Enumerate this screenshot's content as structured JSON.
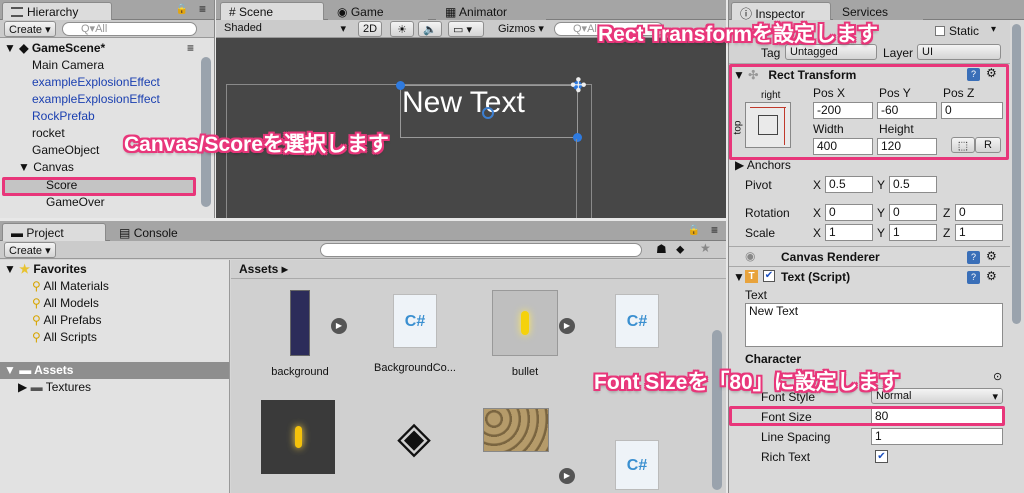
{
  "hierarchy": {
    "tab": "Hierarchy",
    "create": "Create ▾",
    "search_placeholder": "Q▾All",
    "scene": "GameScene*",
    "items": [
      "Main Camera",
      "exampleExplosionEffect",
      "exampleExplosionEffect",
      "RockPrefab",
      "rocket",
      "GameObject",
      "Canvas",
      "Score",
      "GameOver"
    ]
  },
  "scene_view": {
    "tabs": [
      "Scene",
      "Game",
      "Animator"
    ],
    "shading": "Shaded",
    "mode_2d": "2D",
    "gizmos": "Gizmos ▾",
    "search_placeholder": "Q▾All",
    "canvas_text": "New Text"
  },
  "project": {
    "tabs": [
      "Project",
      "Console"
    ],
    "create": "Create ▾",
    "favorites_label": "Favorites",
    "favorites": [
      "All Materials",
      "All Models",
      "All Prefabs",
      "All Scripts"
    ],
    "assets_label": "Assets",
    "textures_label": "Textures",
    "breadcrumb": "Assets ▸",
    "assets": [
      "background",
      "BackgroundCo...",
      "bullet"
    ]
  },
  "inspector": {
    "tabs": [
      "Inspector",
      "Services"
    ],
    "static_label": "Static",
    "tag_label": "Tag",
    "tag_value": "Untagged",
    "layer_label": "Layer",
    "layer_value": "UI",
    "rect_transform": {
      "title": "Rect Transform",
      "anchor_h": "right",
      "anchor_v": "top",
      "pos_x_label": "Pos X",
      "pos_y_label": "Pos Y",
      "pos_z_label": "Pos Z",
      "pos_x": "-200",
      "pos_y": "-60",
      "pos_z": "0",
      "width_label": "Width",
      "height_label": "Height",
      "width": "400",
      "height": "120",
      "r_btn": "R"
    },
    "anchors_label": "Anchors",
    "pivot_label": "Pivot",
    "pivot_x": "0.5",
    "pivot_y": "0.5",
    "rotation_label": "Rotation",
    "rot_x": "0",
    "rot_y": "0",
    "rot_z": "0",
    "scale_label": "Scale",
    "scale_x": "1",
    "scale_y": "1",
    "scale_z": "1",
    "x": "X",
    "y": "Y",
    "z": "Z",
    "canvas_renderer": "Canvas Renderer",
    "text_script": {
      "title": "Text (Script)",
      "text_label": "Text",
      "text_value": "New Text",
      "character_label": "Character",
      "font_style_label": "Font Style",
      "font_style_value": "Normal",
      "font_size_label": "Font Size",
      "font_size_value": "80",
      "line_spacing_label": "Line Spacing",
      "line_spacing_value": "1",
      "rich_text_label": "Rich Text"
    }
  },
  "annotations": {
    "rect": "Rect Transformを設定します",
    "canvas": "Canvas/Scoreを選択します",
    "font": "Font Sizeを「80」に設定します"
  },
  "colors": {
    "highlight": "#e8367a",
    "selected_row": "#c4c4c4"
  }
}
